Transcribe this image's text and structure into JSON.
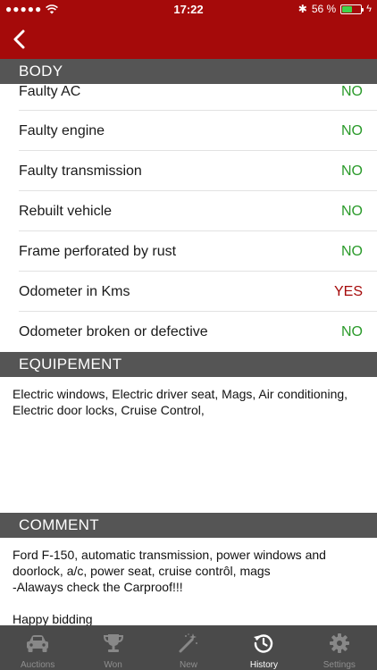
{
  "status_bar": {
    "time": "17:22",
    "battery_percent": "56 %",
    "battery_level": 0.56
  },
  "sections": {
    "body": {
      "title": "BODY",
      "rows": [
        {
          "label": "Faulty AC",
          "value": "NO"
        },
        {
          "label": "Faulty engine",
          "value": "NO"
        },
        {
          "label": "Faulty transmission",
          "value": "NO"
        },
        {
          "label": "Rebuilt vehicle",
          "value": "NO"
        },
        {
          "label": "Frame perforated by rust",
          "value": "NO"
        },
        {
          "label": "Odometer in Kms",
          "value": "YES"
        },
        {
          "label": "Odometer broken or defective",
          "value": "NO"
        }
      ]
    },
    "equipment": {
      "title": "EQUIPEMENT",
      "text": "Electric windows, Electric driver seat, Mags, Air conditioning, Electric door locks, Cruise Control,"
    },
    "comment": {
      "title": "COMMENT",
      "line1": "Ford F-150, automatic transmission, power windows and doorlock, a/c, power seat, cruise contrôl, mags",
      "line2": "-Alaways check the Carproof!!!",
      "line3": "Happy bidding"
    }
  },
  "tabs": [
    {
      "label": "Auctions",
      "icon": "car-icon"
    },
    {
      "label": "Won",
      "icon": "trophy-icon"
    },
    {
      "label": "New",
      "icon": "magic-wand-icon"
    },
    {
      "label": "History",
      "icon": "history-icon",
      "active": true
    },
    {
      "label": "Settings",
      "icon": "gear-icon"
    }
  ],
  "colors": {
    "brand": "#a50a0a",
    "no": "#2a9a2a",
    "yes": "#a50a0a",
    "header_bg": "#555555",
    "tabbar_bg": "#4a4a4a"
  }
}
